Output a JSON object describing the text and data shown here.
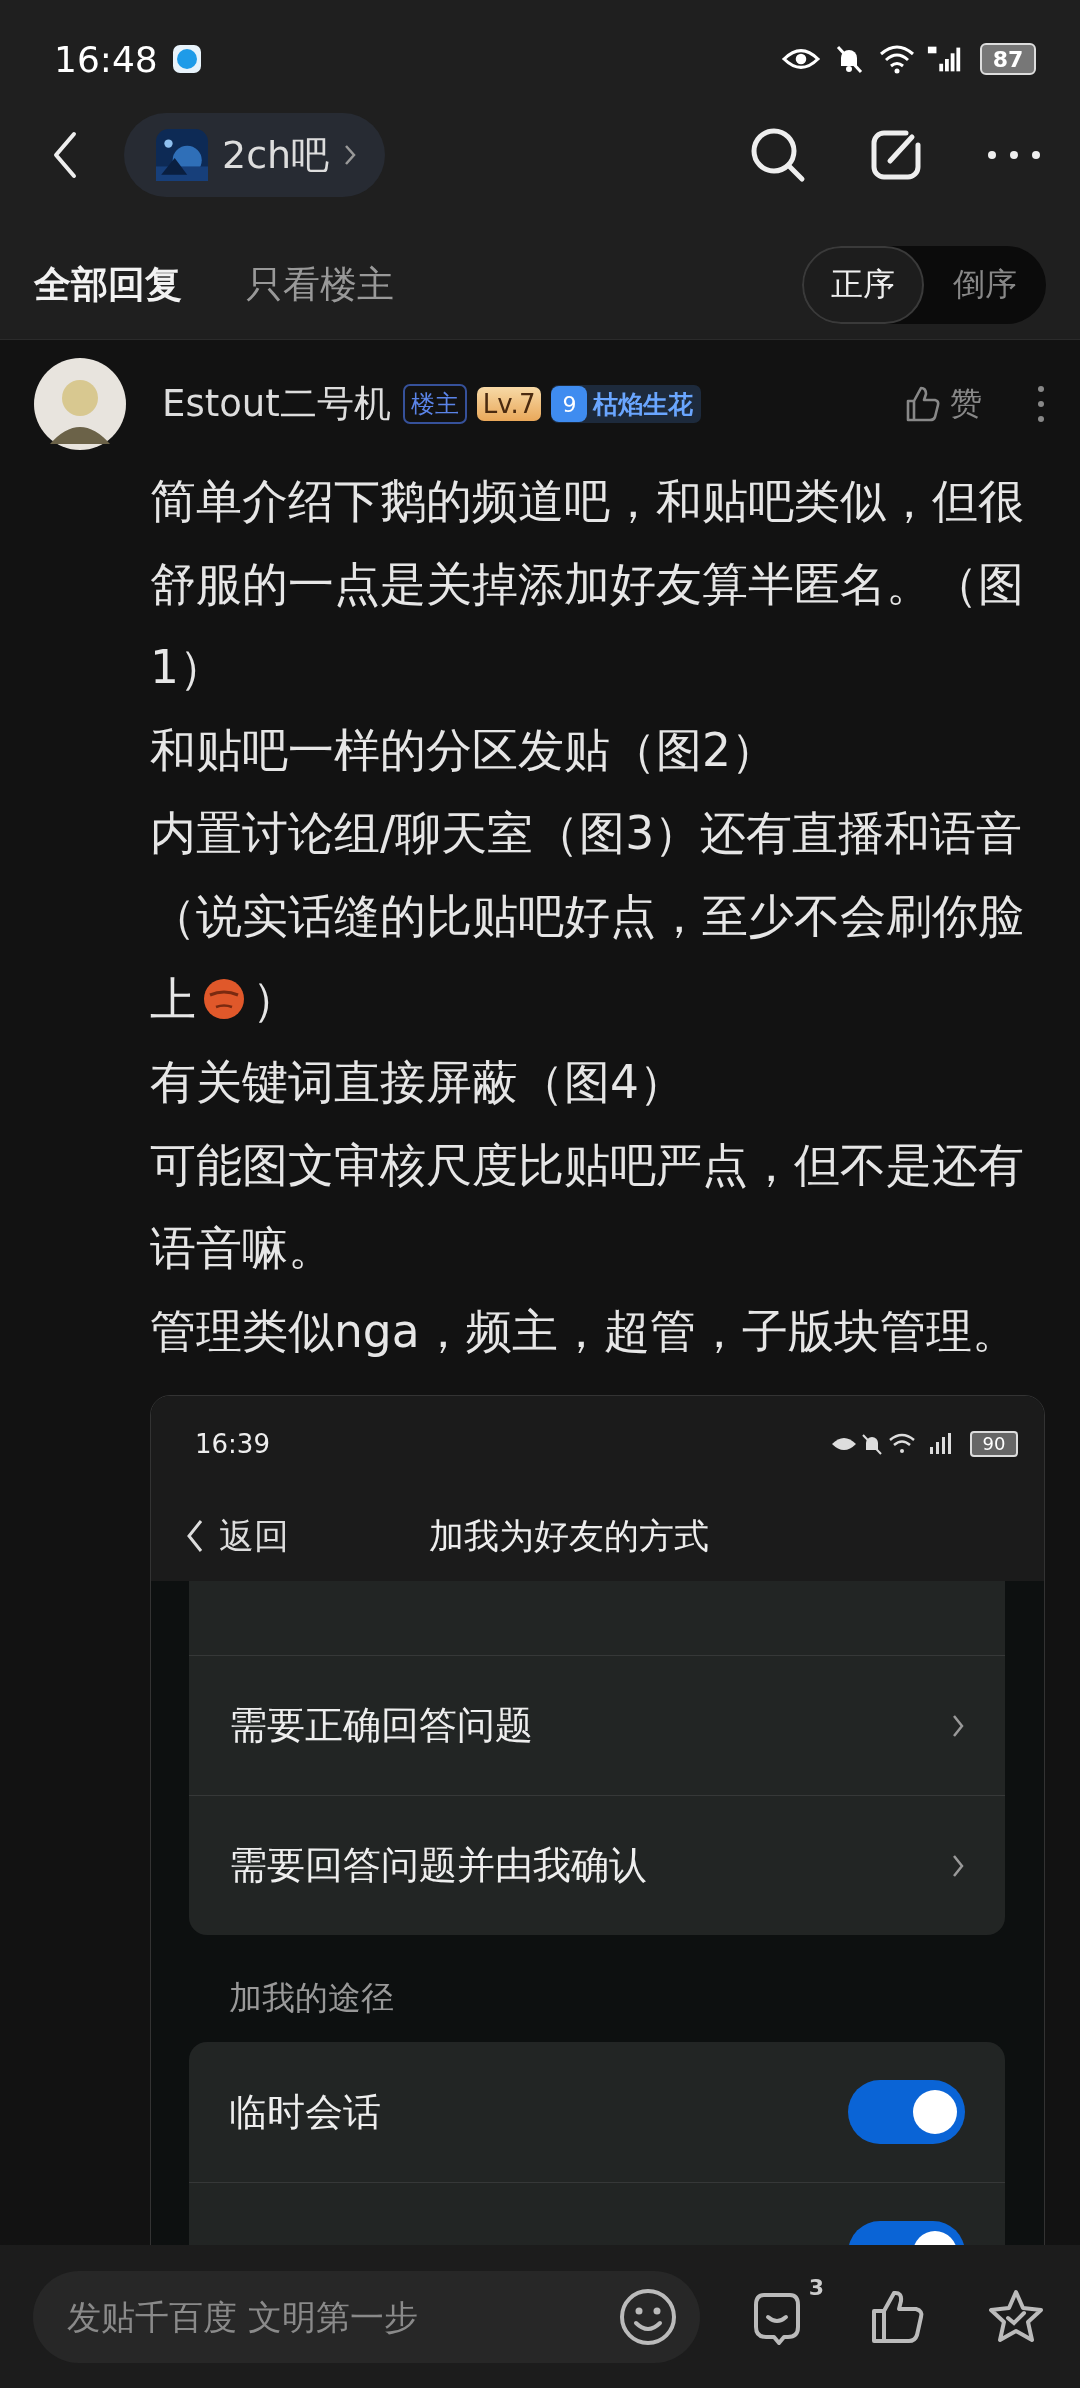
{
  "status_bar": {
    "time": "16:48",
    "battery": "87"
  },
  "header": {
    "forum": "2ch吧"
  },
  "tabs": [
    {
      "label": "全部回复",
      "selected": true
    },
    {
      "label": "只看楼主",
      "selected": false
    }
  ],
  "sort": [
    {
      "label": "正序",
      "selected": true
    },
    {
      "label": "倒序",
      "selected": false
    }
  ],
  "post": {
    "author": "Estout二号机",
    "op_badge": "楼主",
    "level": "Lv.7",
    "fan_level": "9",
    "fan_title": "枯焰生花",
    "like_label": "赞",
    "paragraphs": [
      [
        {
          "kind": "text",
          "text": "简单介绍下鹅的频道吧，和贴吧类似，但很舒服的一点是关掉添加好友算半匿名。（图1）"
        }
      ],
      [
        {
          "kind": "text",
          "text": "和贴吧一样的分区发贴（图2）"
        }
      ],
      [
        {
          "kind": "line",
          "text": "内置讨论组/聊天室（图3）还有直播和语音（说实话缝的比贴吧好点，至少不会刷你脸"
        },
        {
          "kind": "text",
          "text": "上"
        },
        {
          "kind": "emoji"
        },
        {
          "kind": "text",
          "text": "）"
        }
      ],
      [
        {
          "kind": "text",
          "text": "有关键词直接屏蔽（图4）"
        }
      ],
      [
        {
          "kind": "text",
          "text": "可能图文审核尺度比贴吧严点，但不是还有语音嘛。"
        }
      ],
      [
        {
          "kind": "text",
          "text": "管理类似nga，频主，超管，子版块管理。"
        }
      ]
    ],
    "screenshot": {
      "time": "16:39",
      "battery": "90",
      "back": "返回",
      "title": "加我为好友的方式",
      "verify_items": [
        "需要正确回答问题",
        "需要回答问题并由我确认"
      ],
      "section": "加我的途径",
      "ways": [
        {
          "label": "临时会话",
          "on": true
        },
        {
          "on": true
        }
      ]
    }
  },
  "composer": {
    "placeholder": "发贴千百度 文明第一步",
    "comment_count": "3"
  }
}
